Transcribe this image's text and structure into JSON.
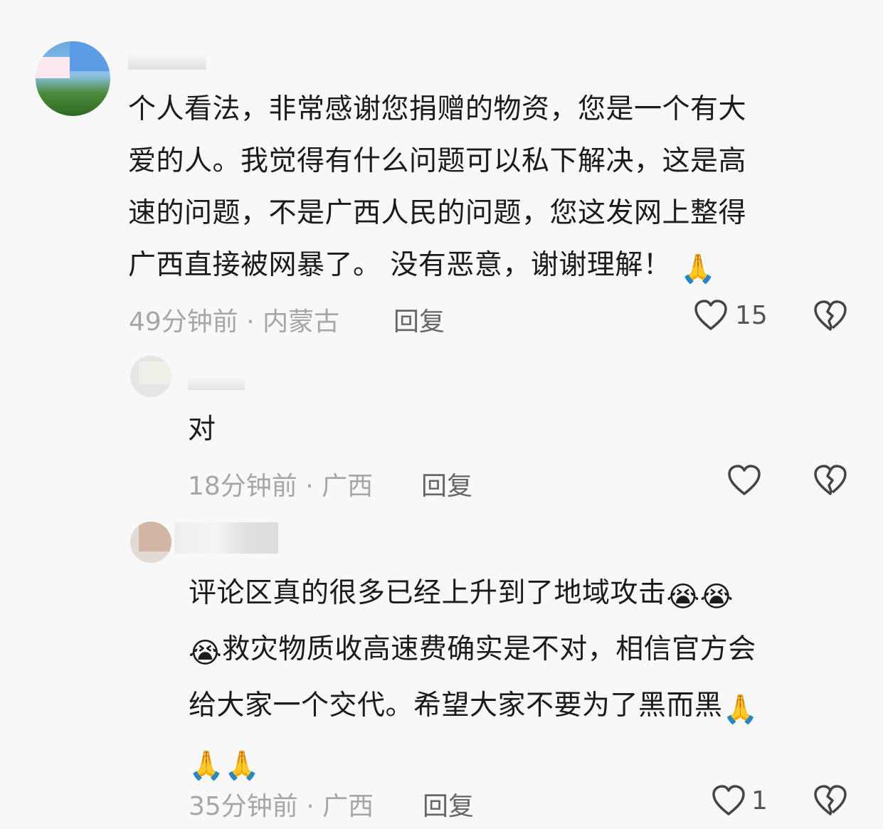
{
  "comments": [
    {
      "text_lines": [
        "个人看法，非常感谢您捐赠的物资，您是一个有大",
        "爱的人。我觉得有什么问题可以私下解决，这是高",
        "速的问题，不是广西人民的问题，您这发网上整得",
        "广西直接被网暴了。 没有恶意，谢谢理解！"
      ],
      "emoji_end": "🙏",
      "time": "49分钟前",
      "location": "内蒙古",
      "reply_label": "回复",
      "likes": "15"
    },
    {
      "text": "对",
      "time": "18分钟前",
      "location": "广西",
      "reply_label": "回复"
    },
    {
      "line1": "评论区真的很多已经上升到了地域攻击",
      "line1_emoji": "😭😭",
      "line2_emoji": "😭",
      "line2": "救灾物质收高速费确实是不对，相信官方会",
      "line3": "给大家一个交代。希望大家不要为了黑而黑",
      "line3_emoji": "🙏",
      "line4_emoji": "🙏🙏",
      "time": "35分钟前",
      "location": "广西",
      "reply_label": "回复",
      "likes": "1"
    }
  ],
  "separator": " · ",
  "icons": {
    "like": "heart-outline-icon",
    "dislike": "broken-heart-icon"
  }
}
